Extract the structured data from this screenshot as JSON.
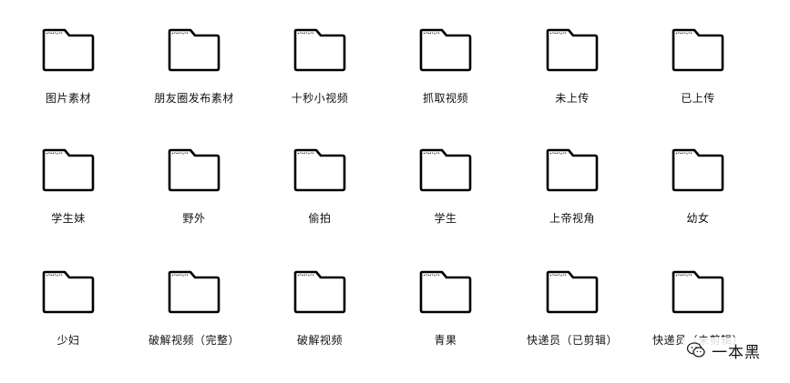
{
  "folders": [
    {
      "label": "图片素材"
    },
    {
      "label": "朋友圈发布素材"
    },
    {
      "label": "十秒小视频"
    },
    {
      "label": "抓取视频"
    },
    {
      "label": "未上传"
    },
    {
      "label": "已上传"
    },
    {
      "label": "学生妹"
    },
    {
      "label": "野外"
    },
    {
      "label": "偷拍"
    },
    {
      "label": "学生"
    },
    {
      "label": "上帝视角"
    },
    {
      "label": "幼女"
    },
    {
      "label": "少妇"
    },
    {
      "label": "破解视频（完整）"
    },
    {
      "label": "破解视频"
    },
    {
      "label": "青果"
    },
    {
      "label": "快递员（已剪辑）"
    },
    {
      "label": "快递员（未剪辑）"
    }
  ],
  "icon": "folder-icon",
  "watermark": {
    "icon": "wechat-logo-icon",
    "text": "一本黑"
  }
}
